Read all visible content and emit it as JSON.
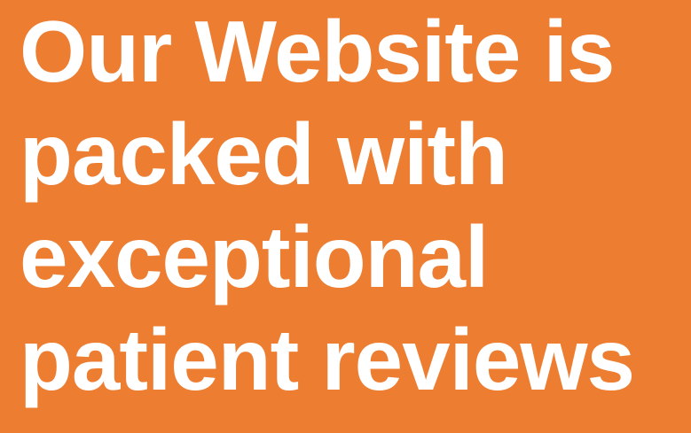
{
  "banner": {
    "background_color": "#ED7D31",
    "text_color": "#FFFFFF",
    "headline_lines": [
      "Our Website is",
      "packed with",
      "exceptional",
      "patient reviews"
    ]
  }
}
